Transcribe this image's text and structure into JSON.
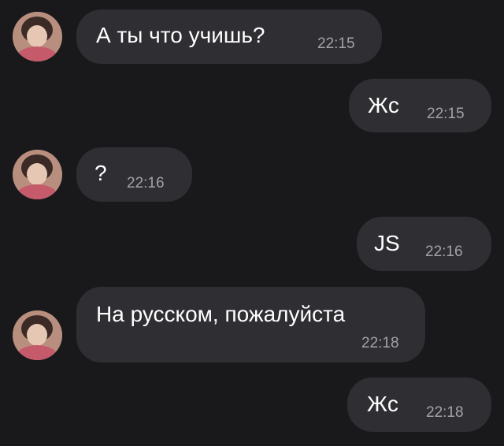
{
  "messages": [
    {
      "direction": "incoming",
      "text": "А ты что учишь?",
      "time": "22:15"
    },
    {
      "direction": "outgoing",
      "text": "Жс",
      "time": "22:15"
    },
    {
      "direction": "incoming",
      "text": "?",
      "time": "22:16"
    },
    {
      "direction": "outgoing",
      "text": "JS",
      "time": "22:16"
    },
    {
      "direction": "incoming",
      "text": "На русском, пожалуйста",
      "time": "22:18"
    },
    {
      "direction": "outgoing",
      "text": "Жс",
      "time": "22:18"
    }
  ],
  "colors": {
    "background": "#19181b",
    "bubble": "#2f2e32",
    "text": "#ffffff",
    "time": "#a3a2a7"
  },
  "icons": {
    "avatar": "contact-photo"
  }
}
